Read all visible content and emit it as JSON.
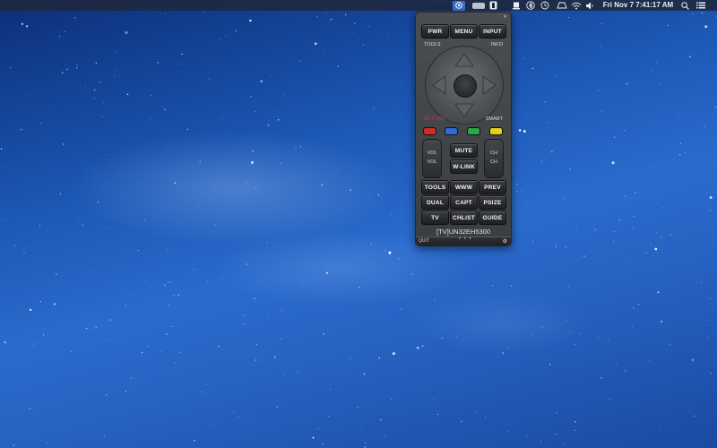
{
  "menubar": {
    "datetime": "Fri Nov 7  7:41:17 AM",
    "app_icon": "remote-app-icon",
    "icons": [
      "remote-app-icon",
      "tv-icon",
      "shield-icon",
      "display-icon",
      "bluetooth-icon",
      "time-machine-icon",
      "airport-icon",
      "wifi-icon",
      "volume-icon",
      "search-icon",
      "list-icon"
    ]
  },
  "remote": {
    "close_glyph": "✕",
    "top_buttons": [
      "PWR",
      "MENU",
      "INPUT"
    ],
    "tools_label": "TOOLS",
    "info_label": "INFO",
    "return_label": "RETURN",
    "smart_label": "SMART",
    "color_buttons": [
      "#d22a2a",
      "#2f6ad6",
      "#2aa84a",
      "#e2d11e"
    ],
    "vol": {
      "up": "VOL",
      "down": "VOL"
    },
    "ch": {
      "up": "CH",
      "down": "CH"
    },
    "mute": "MUTE",
    "wlink": "W-LINK",
    "rows": [
      [
        "TOOLS",
        "WWW",
        "PREV"
      ],
      [
        "DUAL",
        "CAPT",
        "PSIZE"
      ],
      [
        "TV",
        "CHLIST",
        "GUIDE"
      ]
    ],
    "device": "[TV]UN32EH5300",
    "footer": {
      "quit": "QUIT",
      "dots": "• • •",
      "gear": "⚙"
    }
  }
}
